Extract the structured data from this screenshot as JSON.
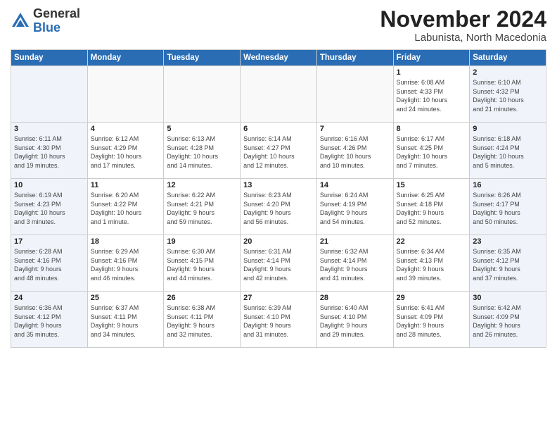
{
  "logo": {
    "general": "General",
    "blue": "Blue"
  },
  "title": "November 2024",
  "location": "Labunista, North Macedonia",
  "days_of_week": [
    "Sunday",
    "Monday",
    "Tuesday",
    "Wednesday",
    "Thursday",
    "Friday",
    "Saturday"
  ],
  "weeks": [
    [
      {
        "day": "",
        "info": ""
      },
      {
        "day": "",
        "info": ""
      },
      {
        "day": "",
        "info": ""
      },
      {
        "day": "",
        "info": ""
      },
      {
        "day": "",
        "info": ""
      },
      {
        "day": "1",
        "info": "Sunrise: 6:08 AM\nSunset: 4:33 PM\nDaylight: 10 hours\nand 24 minutes."
      },
      {
        "day": "2",
        "info": "Sunrise: 6:10 AM\nSunset: 4:32 PM\nDaylight: 10 hours\nand 21 minutes."
      }
    ],
    [
      {
        "day": "3",
        "info": "Sunrise: 6:11 AM\nSunset: 4:30 PM\nDaylight: 10 hours\nand 19 minutes."
      },
      {
        "day": "4",
        "info": "Sunrise: 6:12 AM\nSunset: 4:29 PM\nDaylight: 10 hours\nand 17 minutes."
      },
      {
        "day": "5",
        "info": "Sunrise: 6:13 AM\nSunset: 4:28 PM\nDaylight: 10 hours\nand 14 minutes."
      },
      {
        "day": "6",
        "info": "Sunrise: 6:14 AM\nSunset: 4:27 PM\nDaylight: 10 hours\nand 12 minutes."
      },
      {
        "day": "7",
        "info": "Sunrise: 6:16 AM\nSunset: 4:26 PM\nDaylight: 10 hours\nand 10 minutes."
      },
      {
        "day": "8",
        "info": "Sunrise: 6:17 AM\nSunset: 4:25 PM\nDaylight: 10 hours\nand 7 minutes."
      },
      {
        "day": "9",
        "info": "Sunrise: 6:18 AM\nSunset: 4:24 PM\nDaylight: 10 hours\nand 5 minutes."
      }
    ],
    [
      {
        "day": "10",
        "info": "Sunrise: 6:19 AM\nSunset: 4:23 PM\nDaylight: 10 hours\nand 3 minutes."
      },
      {
        "day": "11",
        "info": "Sunrise: 6:20 AM\nSunset: 4:22 PM\nDaylight: 10 hours\nand 1 minute."
      },
      {
        "day": "12",
        "info": "Sunrise: 6:22 AM\nSunset: 4:21 PM\nDaylight: 9 hours\nand 59 minutes."
      },
      {
        "day": "13",
        "info": "Sunrise: 6:23 AM\nSunset: 4:20 PM\nDaylight: 9 hours\nand 56 minutes."
      },
      {
        "day": "14",
        "info": "Sunrise: 6:24 AM\nSunset: 4:19 PM\nDaylight: 9 hours\nand 54 minutes."
      },
      {
        "day": "15",
        "info": "Sunrise: 6:25 AM\nSunset: 4:18 PM\nDaylight: 9 hours\nand 52 minutes."
      },
      {
        "day": "16",
        "info": "Sunrise: 6:26 AM\nSunset: 4:17 PM\nDaylight: 9 hours\nand 50 minutes."
      }
    ],
    [
      {
        "day": "17",
        "info": "Sunrise: 6:28 AM\nSunset: 4:16 PM\nDaylight: 9 hours\nand 48 minutes."
      },
      {
        "day": "18",
        "info": "Sunrise: 6:29 AM\nSunset: 4:16 PM\nDaylight: 9 hours\nand 46 minutes."
      },
      {
        "day": "19",
        "info": "Sunrise: 6:30 AM\nSunset: 4:15 PM\nDaylight: 9 hours\nand 44 minutes."
      },
      {
        "day": "20",
        "info": "Sunrise: 6:31 AM\nSunset: 4:14 PM\nDaylight: 9 hours\nand 42 minutes."
      },
      {
        "day": "21",
        "info": "Sunrise: 6:32 AM\nSunset: 4:14 PM\nDaylight: 9 hours\nand 41 minutes."
      },
      {
        "day": "22",
        "info": "Sunrise: 6:34 AM\nSunset: 4:13 PM\nDaylight: 9 hours\nand 39 minutes."
      },
      {
        "day": "23",
        "info": "Sunrise: 6:35 AM\nSunset: 4:12 PM\nDaylight: 9 hours\nand 37 minutes."
      }
    ],
    [
      {
        "day": "24",
        "info": "Sunrise: 6:36 AM\nSunset: 4:12 PM\nDaylight: 9 hours\nand 35 minutes."
      },
      {
        "day": "25",
        "info": "Sunrise: 6:37 AM\nSunset: 4:11 PM\nDaylight: 9 hours\nand 34 minutes."
      },
      {
        "day": "26",
        "info": "Sunrise: 6:38 AM\nSunset: 4:11 PM\nDaylight: 9 hours\nand 32 minutes."
      },
      {
        "day": "27",
        "info": "Sunrise: 6:39 AM\nSunset: 4:10 PM\nDaylight: 9 hours\nand 31 minutes."
      },
      {
        "day": "28",
        "info": "Sunrise: 6:40 AM\nSunset: 4:10 PM\nDaylight: 9 hours\nand 29 minutes."
      },
      {
        "day": "29",
        "info": "Sunrise: 6:41 AM\nSunset: 4:09 PM\nDaylight: 9 hours\nand 28 minutes."
      },
      {
        "day": "30",
        "info": "Sunrise: 6:42 AM\nSunset: 4:09 PM\nDaylight: 9 hours\nand 26 minutes."
      }
    ]
  ]
}
